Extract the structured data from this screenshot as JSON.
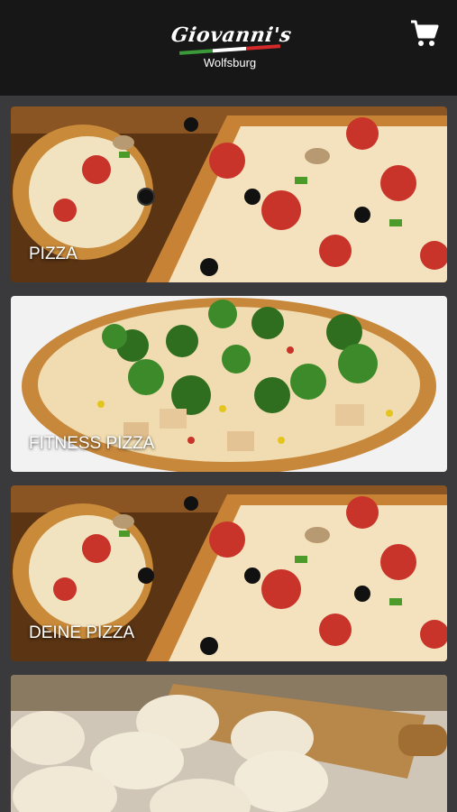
{
  "header": {
    "brand": "Giovanni's",
    "city": "Wolfsburg",
    "cart_icon": "shopping-cart-icon"
  },
  "categories": [
    {
      "label": "PIZZA",
      "image": "pepperoni-pizza-image"
    },
    {
      "label": "FITNESS PIZZA",
      "image": "broccoli-chicken-pizza-image"
    },
    {
      "label": "DEINE PIZZA",
      "image": "pepperoni-pizza-image"
    },
    {
      "label": "",
      "image": "pizza-dough-rolling-pin-image"
    }
  ],
  "colors": {
    "header_bg": "#171717",
    "page_bg": "#3a3a3c",
    "label_text": "#ffffff"
  }
}
